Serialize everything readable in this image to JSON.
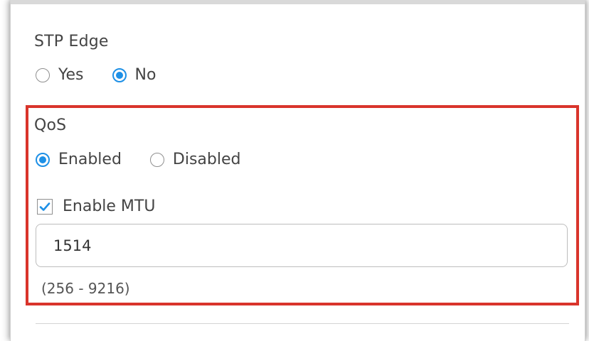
{
  "stp_edge": {
    "label": "STP Edge",
    "options": [
      {
        "label": "Yes",
        "selected": false
      },
      {
        "label": "No",
        "selected": true
      }
    ]
  },
  "qos": {
    "label": "QoS",
    "options": [
      {
        "label": "Enabled",
        "selected": true
      },
      {
        "label": "Disabled",
        "selected": false
      }
    ],
    "enable_mtu": {
      "label": "Enable MTU",
      "checked": true
    },
    "mtu_input": {
      "value": "1514",
      "placeholder": ""
    },
    "mtu_range_hint": "(256 - 9216)"
  },
  "colors": {
    "accent": "#1e90e6",
    "highlight": "#d9342b",
    "text": "#444444"
  }
}
